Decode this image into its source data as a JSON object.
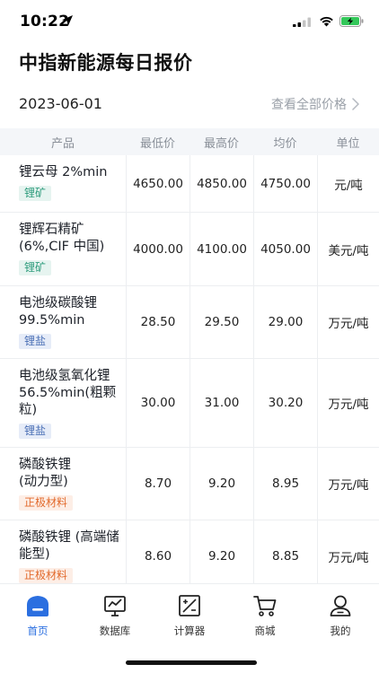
{
  "status_bar": {
    "time": "10:22"
  },
  "header": {
    "title": "中指新能源每日报价"
  },
  "date_row": {
    "date": "2023-06-01",
    "view_all_label": "查看全部价格"
  },
  "table": {
    "headers": [
      "产品",
      "最低价",
      "最高价",
      "均价",
      "单位"
    ],
    "rows": [
      {
        "name": "锂云母 2%min",
        "tag": "锂矿",
        "tag_color": "#2e9c7c",
        "low": "4650.00",
        "high": "4850.00",
        "avg": "4750.00",
        "unit": "元/吨"
      },
      {
        "name": "锂辉石精矿\n(6%,CIF 中国)",
        "tag": "锂矿",
        "tag_color": "#2e9c7c",
        "low": "4000.00",
        "high": "4100.00",
        "avg": "4050.00",
        "unit": "美元/吨"
      },
      {
        "name": "电池级碳酸锂\n99.5%min",
        "tag": "锂盐",
        "tag_color": "#4a6fb5",
        "low": "28.50",
        "high": "29.50",
        "avg": "29.00",
        "unit": "万元/吨"
      },
      {
        "name": "电池级氢氧化锂\n56.5%min(粗颗\n粒)",
        "tag": "锂盐",
        "tag_color": "#4a6fb5",
        "low": "30.00",
        "high": "31.00",
        "avg": "30.20",
        "unit": "万元/吨"
      },
      {
        "name": "磷酸铁锂\n(动力型)",
        "tag": "正极材料",
        "tag_color": "#e26a2c",
        "low": "8.70",
        "high": "9.20",
        "avg": "8.95",
        "unit": "万元/吨"
      },
      {
        "name": "磷酸铁锂 (高端储\n能型)",
        "tag": "正极材料",
        "tag_color": "#e26a2c",
        "low": "8.60",
        "high": "9.20",
        "avg": "8.85",
        "unit": "万元/吨"
      }
    ]
  },
  "tabbar": {
    "tabs": [
      {
        "label": "首页",
        "icon": "home-icon",
        "active": true
      },
      {
        "label": "数据库",
        "icon": "database-chart-icon",
        "active": false
      },
      {
        "label": "计算器",
        "icon": "calculator-icon",
        "active": false
      },
      {
        "label": "商城",
        "icon": "shopping-cart-icon",
        "active": false
      },
      {
        "label": "我的",
        "icon": "user-icon",
        "active": false
      }
    ],
    "accent_color": "#2b6fe0"
  }
}
